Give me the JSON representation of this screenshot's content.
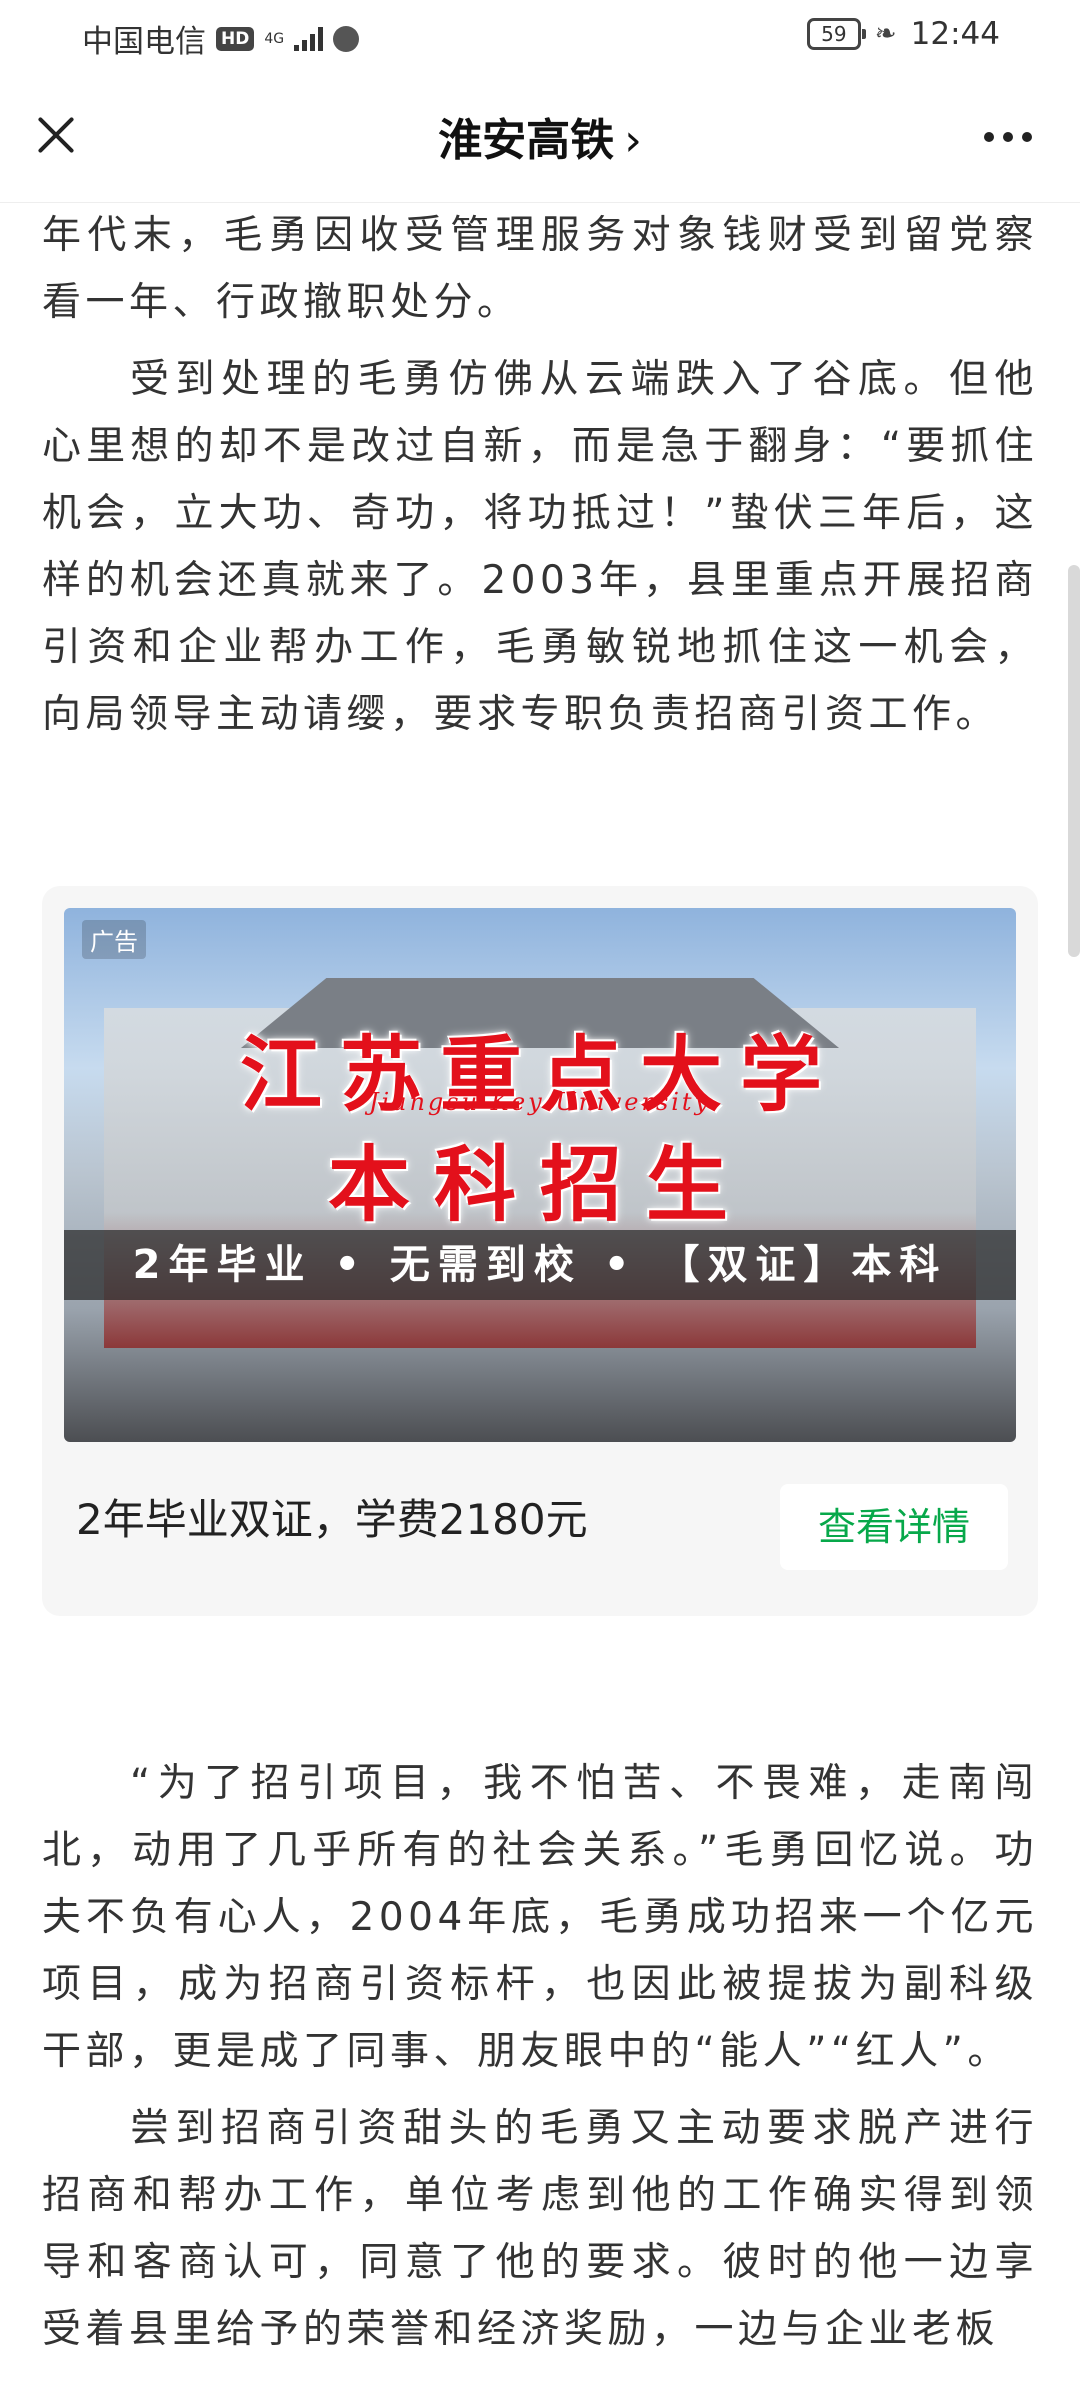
{
  "status_bar": {
    "carrier": "中国电信",
    "hd": "HD",
    "network": "4G",
    "battery": "59",
    "time": "12:44"
  },
  "nav": {
    "title": "淮安高铁",
    "chevron": "›",
    "close_icon": "close-icon",
    "more_icon": "more-icon"
  },
  "article": {
    "paragraphs_top": [
      "年代末，毛勇因收受管理服务对象钱财受到留党察看一年、行政撤职处分。",
      "受到处理的毛勇仿佛从云端跌入了谷底。但他心里想的却不是改过自新，而是急于翻身：“要抓住机会，立大功、奇功，将功抵过！”蛰伏三年后，这样的机会还真就来了。2003年，县里重点开展招商引资和企业帮办工作，毛勇敏锐地抓住这一机会，向局领导主动请缨，要求专职负责招商引资工作。"
    ],
    "paragraphs_bottom": [
      "“为了招引项目，我不怕苦、不畏难，走南闯北，动用了几乎所有的社会关系。”毛勇回忆说。功夫不负有心人，2004年底，毛勇成功招来一个亿元项目，成为招商引资标杆，也因此被提拔为副科级干部，更是成了同事、朋友眼中的“能人”“红人”。",
      "尝到招商引资甜头的毛勇又主动要求脱产进行招商和帮办工作，单位考虑到他的工作确实得到领导和客商认可，同意了他的要求。彼时的他一边享受着县里给予的荣誉和经济奖励，一边与企业老板"
    ]
  },
  "ad": {
    "tag": "广告",
    "headline1": "江苏重点大学",
    "subtitle": "Jiangsu Key University",
    "headline2": "本科招生",
    "band": "2年毕业 • 无需到校 • 【双证】本科",
    "caption": "2年毕业双证，学费2180元",
    "cta": "查看详情",
    "cta_color": "#07a84a"
  }
}
